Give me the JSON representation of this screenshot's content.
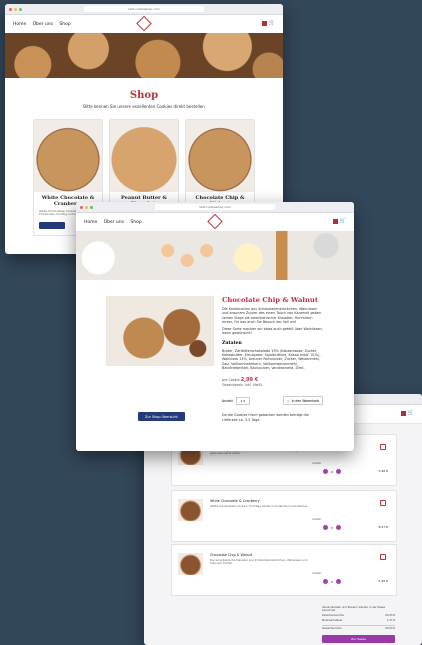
{
  "browser": {
    "url": "test.cookieshop.com"
  },
  "nav": {
    "home": "Home",
    "about": "Über uns",
    "shop": "Shop"
  },
  "shop": {
    "title": "Shop",
    "subtitle": "Bitte kennen Sie unsere exzellenten Cookies direkt bestellen",
    "cards": [
      {
        "title": "White Chocolate & Cranberry",
        "desc": "Weiße Schokoladen-Chunks und süß-saure Cranberries, fruchtig und köstlich."
      },
      {
        "title": "Peanut Butter & Chocolate",
        "desc": ""
      },
      {
        "title": "Chocolate Chip & Walnut",
        "desc": ""
      }
    ]
  },
  "product": {
    "title": "Chocolate Chip & Walnut",
    "intro": "Die Kombination aus Schokoladenstückchen, Walnüssen und braunem Zucker des einen Touch von Karamell geben seinen Siege als amerikanischer Klassiker. Himmlisch lecker, für das auch Sie Besuch der Voll wir!",
    "note": "Diese Sorte machen wir bloss auch geteilt über Walnüssen, wenn gewünscht!",
    "ingredients_title": "Zutaten",
    "ingredients": "Butter, Zartbitterschokolade 19% (Kakaomasse, Zucker, Kakaobutter, Emulgator: Sojalecithine, Kakao entöl. 01%), Walnüsse 13%, brauner Rohrzucker, Zucker, Weizenmehl, Salz, Vollkornhaferkern, Vollkornweizenmehl, Backtriebmittel, Backpulver, Vanillearoma, Zimt.",
    "price_label": "pro Cookie",
    "price": "2,99 €",
    "price_sub": "Gesamtpreis: inkl. MwSt.",
    "qty_label": "Anzahl",
    "qty": "1",
    "add_button": "In den Warenkorb",
    "shipping": "Da die Cookies frisch gebacken werden beträgt die Lieferzeit ca. 3-5 Tage.",
    "back_button": "Zur Shop Übersicht"
  },
  "cart": {
    "items": [
      {
        "title": "Peanut Butter & Chocolate",
        "desc": "Die Mischung aus gesalzener Erdnussbutter, Schokolade, cremig und ganz besonders lecker.",
        "qty_label": "Anzahl",
        "qty": "2",
        "price": "5,98 €"
      },
      {
        "title": "White Chocolate & Cranberry",
        "desc": "Weiße Schokoladen-Chunks, fruchtige Vanille und süß-saure Cranberries.",
        "qty_label": "Anzahl",
        "qty": "3",
        "price": "8,97 €"
      },
      {
        "title": "Chocolate Chip & Walnut",
        "desc": "Der amerikanische Klassiker aus Schokoladenstückchen, Walnüssen und braunem Zucker.",
        "qty_label": "Anzahl",
        "qty": "2",
        "price": "5,98 €"
      }
    ],
    "summary": {
      "note": "Versandkosten und Steuern werden in der Kasse berechnet",
      "rows": [
        {
          "label": "Zwischensumme",
          "value": "20,93 €"
        },
        {
          "label": "Mehrwertsteuer",
          "value": "1,37 €"
        },
        {
          "label": "Gesamtsumme",
          "value": "20,93 €"
        }
      ],
      "pay_button": "Zur Kasse"
    }
  },
  "colors": {
    "accent": "#c0303a",
    "button": "#253a7a",
    "purple": "#9b3aa6",
    "background": "#33475a"
  }
}
